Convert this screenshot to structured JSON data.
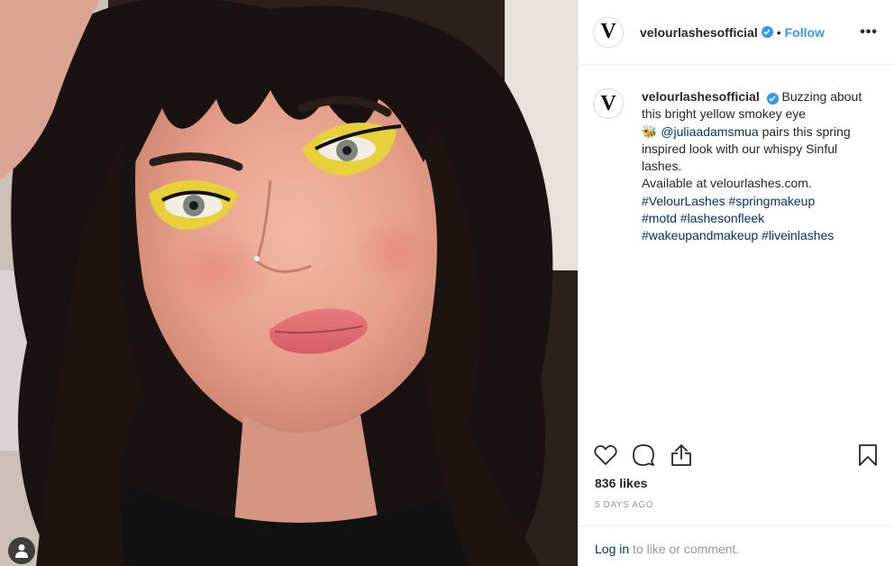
{
  "post": {
    "username": "velourlashesofficial",
    "avatar_letter": "V",
    "follow_separator": "•",
    "follow_label": "Follow",
    "more_label": "•••"
  },
  "caption": {
    "username": "velourlashesofficial",
    "text_1": "Buzzing about this bright yellow smokey eye",
    "emoji": "🐝",
    "mention": "@juliaadamsmua",
    "text_2": "pairs this spring inspired look with our whispy Sinful lashes.",
    "text_3": "Available at velourlashes.com.",
    "hashtags": [
      "#VelourLashes",
      "#springmakeup",
      "#motd",
      "#lashesonfleek",
      "#wakeupandmakeup",
      "#liveinlashes"
    ]
  },
  "engagement": {
    "likes": "836 likes",
    "time": "5 DAYS AGO"
  },
  "footer": {
    "login_link": "Log in",
    "login_text": "to like or comment."
  },
  "icons": {
    "verified": "verified-badge-icon",
    "like": "heart-icon",
    "comment": "comment-bubble-icon",
    "share": "share-upload-icon",
    "save": "bookmark-icon",
    "tag": "user-tag-icon"
  },
  "colors": {
    "accent": "#3897f0",
    "link": "#003569",
    "muted": "#999999",
    "text": "#262626"
  }
}
